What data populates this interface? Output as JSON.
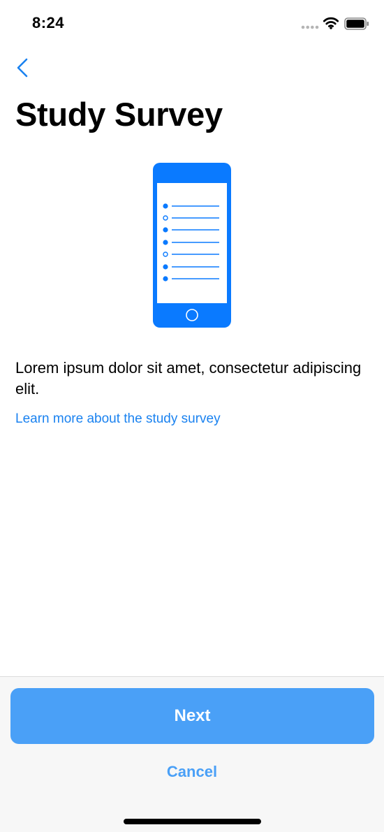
{
  "status_bar": {
    "time": "8:24",
    "icons": [
      "signal-dots-icon",
      "wifi-icon",
      "battery-icon"
    ]
  },
  "nav": {
    "back_icon": "chevron-left-icon"
  },
  "content": {
    "title": "Study Survey",
    "illustration_icon": "phone-survey-icon",
    "body": "Lorem ipsum dolor sit amet, consectetur adipiscing elit.",
    "link": "Learn more about the study survey"
  },
  "footer": {
    "next_label": "Next",
    "cancel_label": "Cancel"
  },
  "colors": {
    "accent": "#1a82f0",
    "button": "#4aa0f7",
    "illustration": "#0a7aff",
    "footer_bg": "#f7f7f7"
  }
}
